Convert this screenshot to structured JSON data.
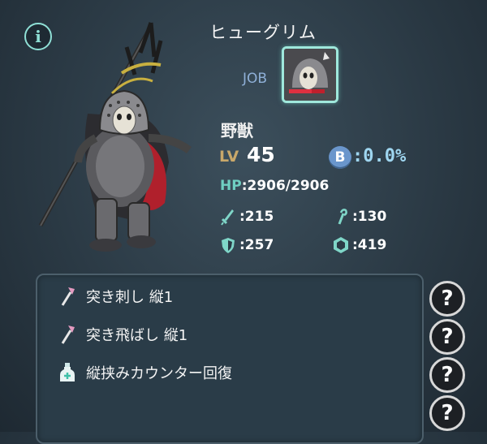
{
  "character": {
    "name": "ヒューグリム",
    "job_label": "JOB",
    "class_name": "野獣",
    "level_label": "LV",
    "level": "45",
    "break_icon_letter": "B",
    "break_rate": ":0.0%",
    "hp_label": "HP",
    "hp_value": ":2906/2906"
  },
  "stats": {
    "attack": ":215",
    "magic": ":130",
    "defense": ":257",
    "magic_defense": ":419"
  },
  "skills": [
    {
      "icon": "pink-spear-icon",
      "label": "突き刺し 縦1"
    },
    {
      "icon": "pink-spear-icon",
      "label": "突き飛ばし 縦1"
    },
    {
      "icon": "potion-bottle-icon",
      "label": "縦挟みカウンター回復"
    }
  ],
  "buttons": {
    "info_glyph": "i",
    "help_glyph": "?"
  },
  "colors": {
    "accent_teal": "#8fe0d6",
    "panel_bg": "#2a3c48",
    "level_gold": "#c9a86a",
    "break_blue": "#9fd6f0"
  }
}
